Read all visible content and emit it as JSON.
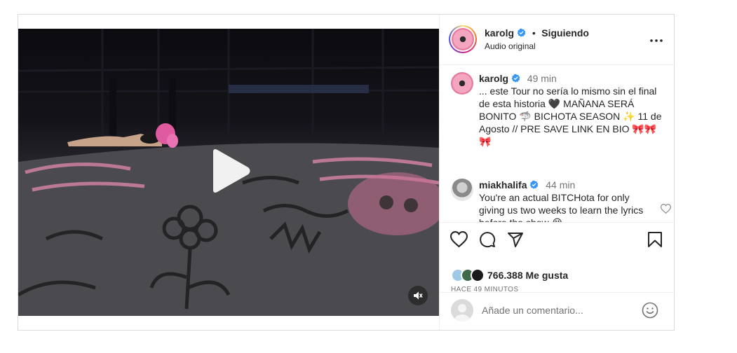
{
  "post": {
    "author": "karolg",
    "follow_status": "Siguiendo",
    "separator": "•",
    "audio": "Audio original",
    "caption": {
      "author": "karolg",
      "time": "49 min",
      "text": "... este Tour no sería lo mismo sin el final de esta historia 🖤 MAÑANA SERÁ BONITO 🦈 BICHOTA SEASON ✨ 11 de Agosto // PRE SAVE LINK EN BIO 🎀🎀🎀"
    },
    "comment": {
      "author": "miakhalifa",
      "time": "44 min",
      "text": "You're an actual BITCHota for only giving us two weeks to learn the lyrics before the show 😭"
    },
    "likes": "766.388 Me gusta",
    "posted_ago": "HACE 49 MINUTOS",
    "add_comment_placeholder": "Añade un comentario..."
  },
  "icons": {
    "verified": "verified-badge-icon",
    "more": "more-options-icon",
    "like": "heart-icon",
    "comment": "comment-icon",
    "share": "share-icon",
    "save": "bookmark-icon",
    "play": "play-icon",
    "mute": "muted-speaker-icon",
    "emoji": "emoji-icon"
  },
  "colors": {
    "verified": "#3897f0",
    "secondary_text": "#737373",
    "border": "#dbdbdb"
  }
}
